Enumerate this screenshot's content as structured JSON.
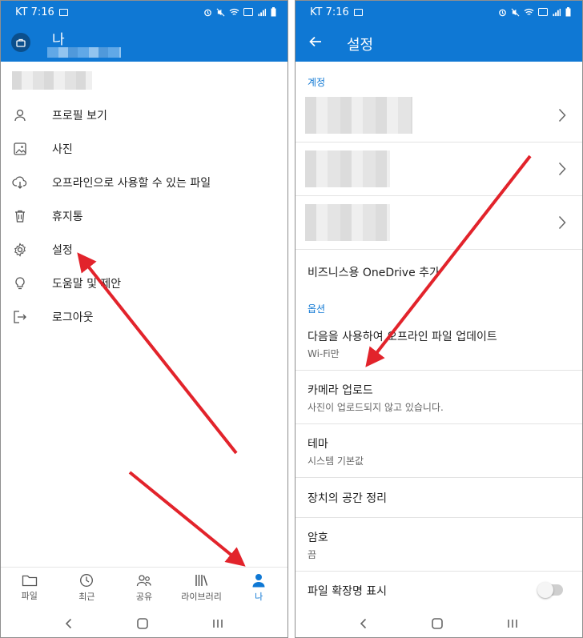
{
  "statusbar": {
    "carrier_time": "KT 7:16",
    "battery_text": ""
  },
  "left_screen": {
    "user_name": "나",
    "menu": [
      {
        "label": "프로필 보기",
        "icon": "profile-icon"
      },
      {
        "label": "사진",
        "icon": "photo-icon"
      },
      {
        "label": "오프라인으로 사용할 수 있는 파일",
        "icon": "cloud-download-icon"
      },
      {
        "label": "휴지통",
        "icon": "trash-icon"
      },
      {
        "label": "설정",
        "icon": "gear-icon"
      },
      {
        "label": "도움말 및 제안",
        "icon": "lightbulb-icon"
      },
      {
        "label": "로그아웃",
        "icon": "sign-out-icon"
      }
    ],
    "tabs": [
      {
        "label": "파일",
        "icon": "folder-icon"
      },
      {
        "label": "최근",
        "icon": "clock-icon"
      },
      {
        "label": "공유",
        "icon": "people-icon"
      },
      {
        "label": "라이브러리",
        "icon": "library-icon"
      },
      {
        "label": "나",
        "icon": "person-icon",
        "active": true
      }
    ]
  },
  "right_screen": {
    "title": "설정",
    "section_account": "계정",
    "add_business": "비즈니스용 OneDrive 추가",
    "section_options": "옵션",
    "options": [
      {
        "title": "다음을 사용하여 오프라인 파일 업데이트",
        "subtitle": "Wi-Fi만"
      },
      {
        "title": "카메라 업로드",
        "subtitle": "사진이 업로드되지 않고 있습니다."
      },
      {
        "title": "테마",
        "subtitle": "시스템 기본값"
      },
      {
        "title": "장치의 공간 정리",
        "subtitle": ""
      },
      {
        "title": "암호",
        "subtitle": "끔"
      },
      {
        "title": "파일 확장명 표시",
        "subtitle": ""
      }
    ]
  },
  "colors": {
    "accent": "#0f78d4",
    "annotation_arrow": "#e2232b"
  }
}
